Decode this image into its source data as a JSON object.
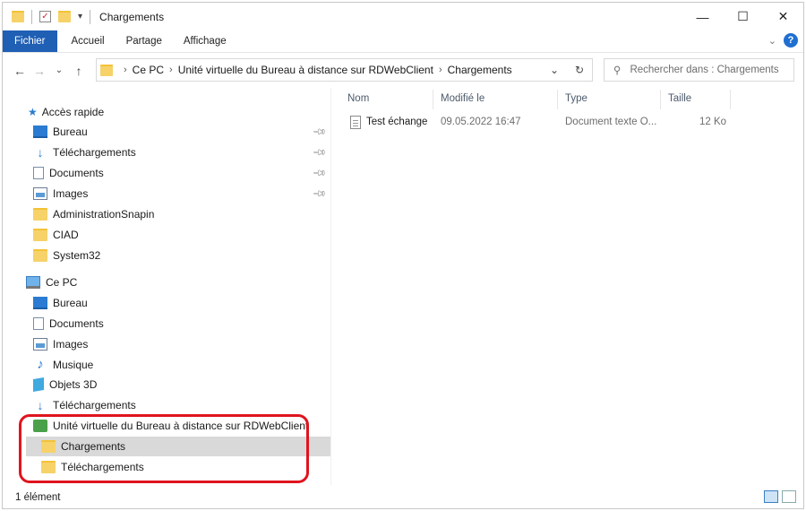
{
  "window": {
    "title": "Chargements"
  },
  "ribbon": {
    "tabs": [
      "Fichier",
      "Accueil",
      "Partage",
      "Affichage"
    ]
  },
  "address": {
    "crumbs": [
      "Ce PC",
      "Unité virtuelle du Bureau à distance sur RDWebClient",
      "Chargements"
    ]
  },
  "search": {
    "placeholder": "Rechercher dans : Chargements"
  },
  "nav": {
    "quick_access": "Accès rapide",
    "quick_items": [
      "Bureau",
      "Téléchargements",
      "Documents",
      "Images",
      "AdministrationSnapin",
      "CIAD",
      "System32"
    ],
    "this_pc": "Ce PC",
    "pc_items": [
      "Bureau",
      "Documents",
      "Images",
      "Musique",
      "Objets 3D",
      "Téléchargements"
    ],
    "drive": "Unité virtuelle du Bureau à distance sur RDWebClient",
    "drive_items": [
      "Chargements",
      "Téléchargements"
    ]
  },
  "list": {
    "columns": [
      "Nom",
      "Modifié le",
      "Type",
      "Taille"
    ],
    "rows": [
      {
        "name": "Test échange",
        "modified": "09.05.2022 16:47",
        "type": "Document texte O...",
        "size": "12 Ko"
      }
    ]
  },
  "status": {
    "count": "1 élément"
  },
  "colors": {
    "accent": "#1f5fb4",
    "highlight": "#e0141e",
    "selection": "#d9d9d9"
  }
}
